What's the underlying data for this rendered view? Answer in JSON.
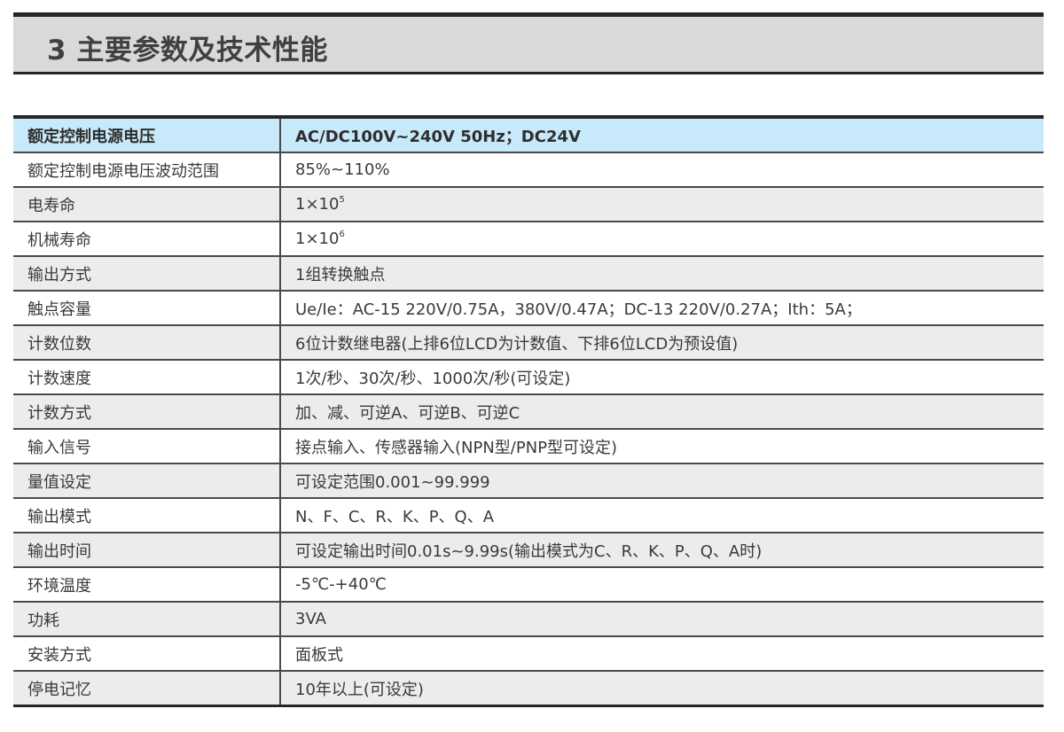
{
  "section": {
    "title": "3 主要参数及技术性能"
  },
  "specs": [
    {
      "label": "额定控制电源电压",
      "value": "AC/DC100V~240V 50Hz；DC24V"
    },
    {
      "label": "额定控制电源电压波动范围",
      "value": "85%~110%"
    },
    {
      "label": "电寿命",
      "value": "1×10",
      "sup": "5"
    },
    {
      "label": "机械寿命",
      "value": "1×10",
      "sup": "6"
    },
    {
      "label": "输出方式",
      "value": "1组转换触点"
    },
    {
      "label": "触点容量",
      "value": "Ue/Ie：AC-15 220V/0.75A，380V/0.47A；DC-13 220V/0.27A；Ith：5A；"
    },
    {
      "label": "计数位数",
      "value": "6位计数继电器(上排6位LCD为计数值、下排6位LCD为预设值)"
    },
    {
      "label": "计数速度",
      "value": "1次/秒、30次/秒、1000次/秒(可设定)"
    },
    {
      "label": "计数方式",
      "value": "加、减、可逆A、可逆B、可逆C"
    },
    {
      "label": "输入信号",
      "value": "接点输入、传感器输入(NPN型/PNP型可设定)"
    },
    {
      "label": "量值设定",
      "value": "可设定范围0.001~99.999"
    },
    {
      "label": "输出模式",
      "value": "N、F、C、R、K、P、Q、A"
    },
    {
      "label": "输出时间",
      "value": "可设定输出时间0.01s~9.99s(输出模式为C、R、K、P、Q、A时)"
    },
    {
      "label": "环境温度",
      "value": "-5℃-+40℃"
    },
    {
      "label": "功耗",
      "value": "3VA"
    },
    {
      "label": "安装方式",
      "value": "面板式"
    },
    {
      "label": "停电记忆",
      "value": "10年以上(可设定)"
    }
  ]
}
